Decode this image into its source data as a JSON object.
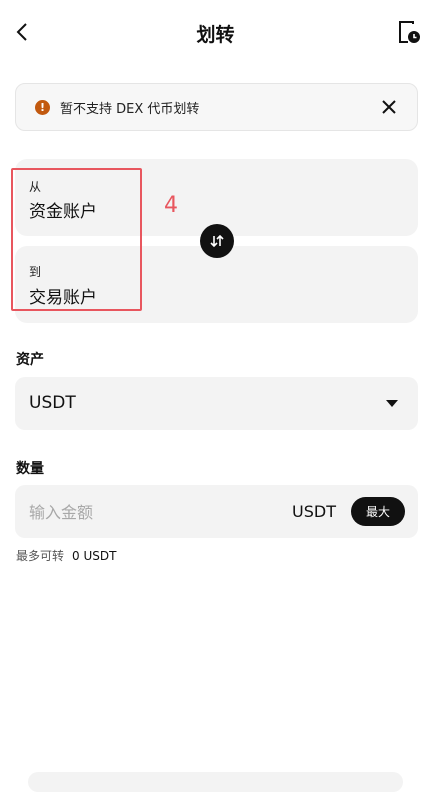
{
  "header": {
    "title": "划转"
  },
  "notice": {
    "text": "暂不支持 DEX 代币划转",
    "warn_symbol": "!"
  },
  "transfer": {
    "from_label": "从",
    "from_account": "资金账户",
    "to_label": "到",
    "to_account": "交易账户",
    "annotation": "4"
  },
  "asset": {
    "label": "资产",
    "value": "USDT"
  },
  "amount": {
    "label": "数量",
    "placeholder": "输入金额",
    "unit": "USDT",
    "max_label": "最大"
  },
  "available": {
    "label": "最多可转",
    "value": "0 USDT"
  },
  "colors": {
    "accent": "#111111",
    "annotation": "#e8565e",
    "warning": "#c2590f"
  }
}
